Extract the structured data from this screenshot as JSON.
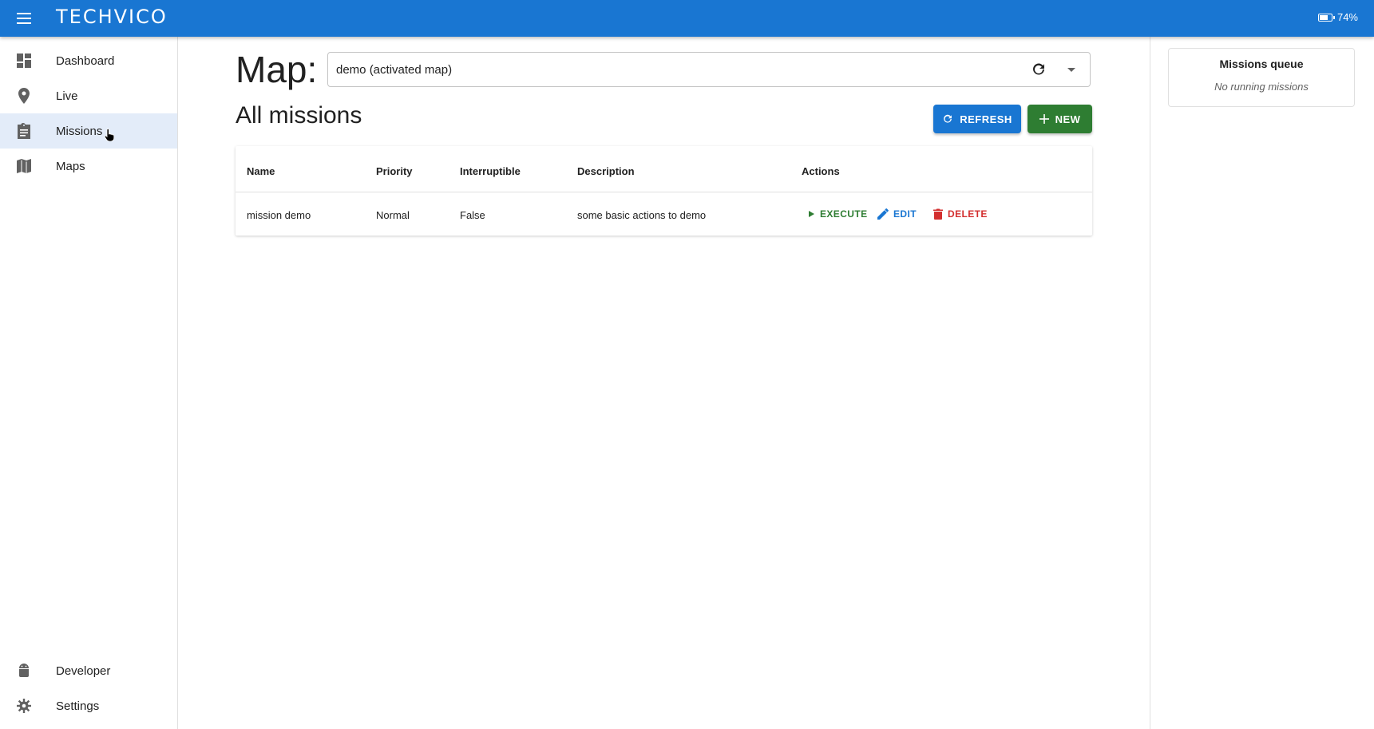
{
  "app": {
    "logo_text": "TECHVICO",
    "battery": "74%"
  },
  "sidebar": {
    "items": [
      {
        "label": "Dashboard",
        "icon": "dashboard-icon"
      },
      {
        "label": "Live",
        "icon": "location-pin-icon"
      },
      {
        "label": "Missions",
        "icon": "clipboard-icon",
        "active": true
      },
      {
        "label": "Maps",
        "icon": "map-icon"
      }
    ],
    "bottom_items": [
      {
        "label": "Developer",
        "icon": "android-icon"
      },
      {
        "label": "Settings",
        "icon": "gear-icon"
      }
    ]
  },
  "main": {
    "map_label": "Map:",
    "map_select_value": "demo (activated map)",
    "section_title": "All missions",
    "refresh_label": "REFRESH",
    "new_label": "NEW",
    "table": {
      "headers": [
        "Name",
        "Priority",
        "Interruptible",
        "Description",
        "Actions"
      ],
      "rows": [
        {
          "name": "mission demo",
          "priority": "Normal",
          "interruptible": "False",
          "description": "some basic actions to demo",
          "actions": {
            "execute": "EXECUTE",
            "edit": "EDIT",
            "delete": "DELETE"
          }
        }
      ]
    }
  },
  "queue": {
    "title": "Missions queue",
    "empty_text": "No running missions"
  },
  "colors": {
    "primary": "#1976d2",
    "success": "#2e7d32",
    "danger": "#d32f2f",
    "active_nav": "#e3ecf9"
  }
}
